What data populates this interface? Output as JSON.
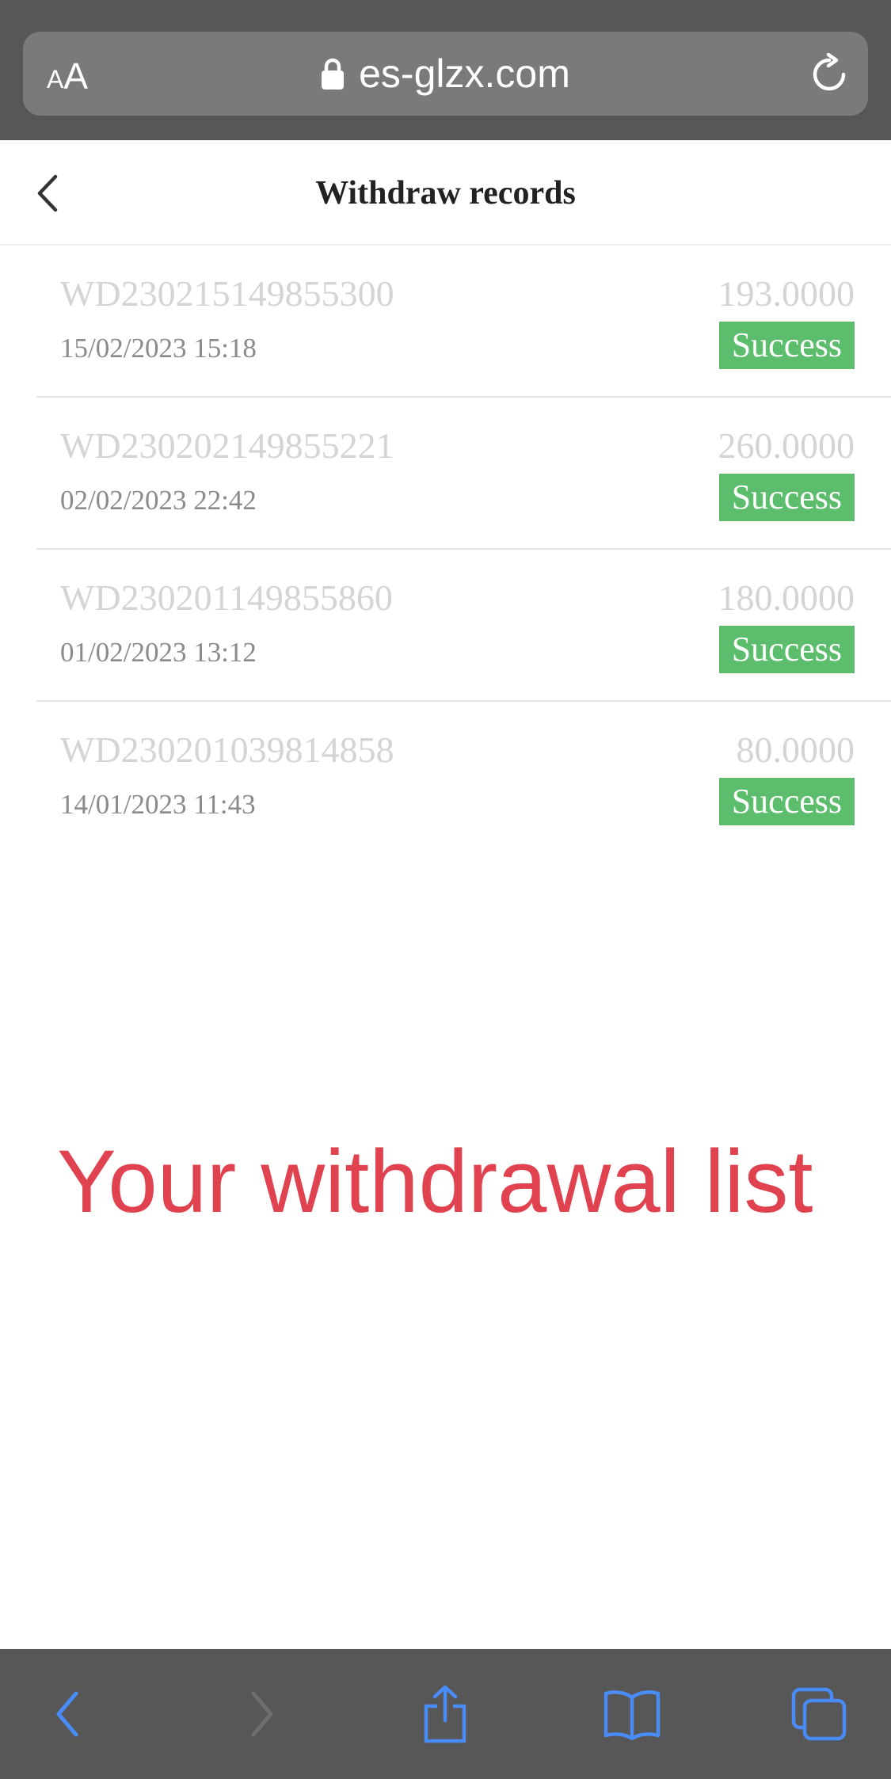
{
  "browser": {
    "text_size_label_small": "A",
    "text_size_label_large": "A",
    "url": "es-glzx.com"
  },
  "header": {
    "title": "Withdraw records"
  },
  "records": [
    {
      "id": "WD230215149855300",
      "date": "15/02/2023 15:18",
      "amount": "193.0000",
      "status": "Success"
    },
    {
      "id": "WD230202149855221",
      "date": "02/02/2023 22:42",
      "amount": "260.0000",
      "status": "Success"
    },
    {
      "id": "WD230201149855860",
      "date": "01/02/2023 13:12",
      "amount": "180.0000",
      "status": "Success"
    },
    {
      "id": "WD230201039814858",
      "date": "14/01/2023 11:43",
      "amount": "80.0000",
      "status": "Success"
    }
  ],
  "overlay": {
    "caption": "Your withdrawal list"
  },
  "toolbar": {
    "icons": [
      "back-icon",
      "forward-icon",
      "share-icon",
      "bookmarks-icon",
      "tabs-icon"
    ]
  },
  "colors": {
    "success": "#5cbe6c",
    "caption": "#e0434f",
    "toolbar_icon": "#4a8cf7",
    "browser_chrome": "#575757"
  }
}
